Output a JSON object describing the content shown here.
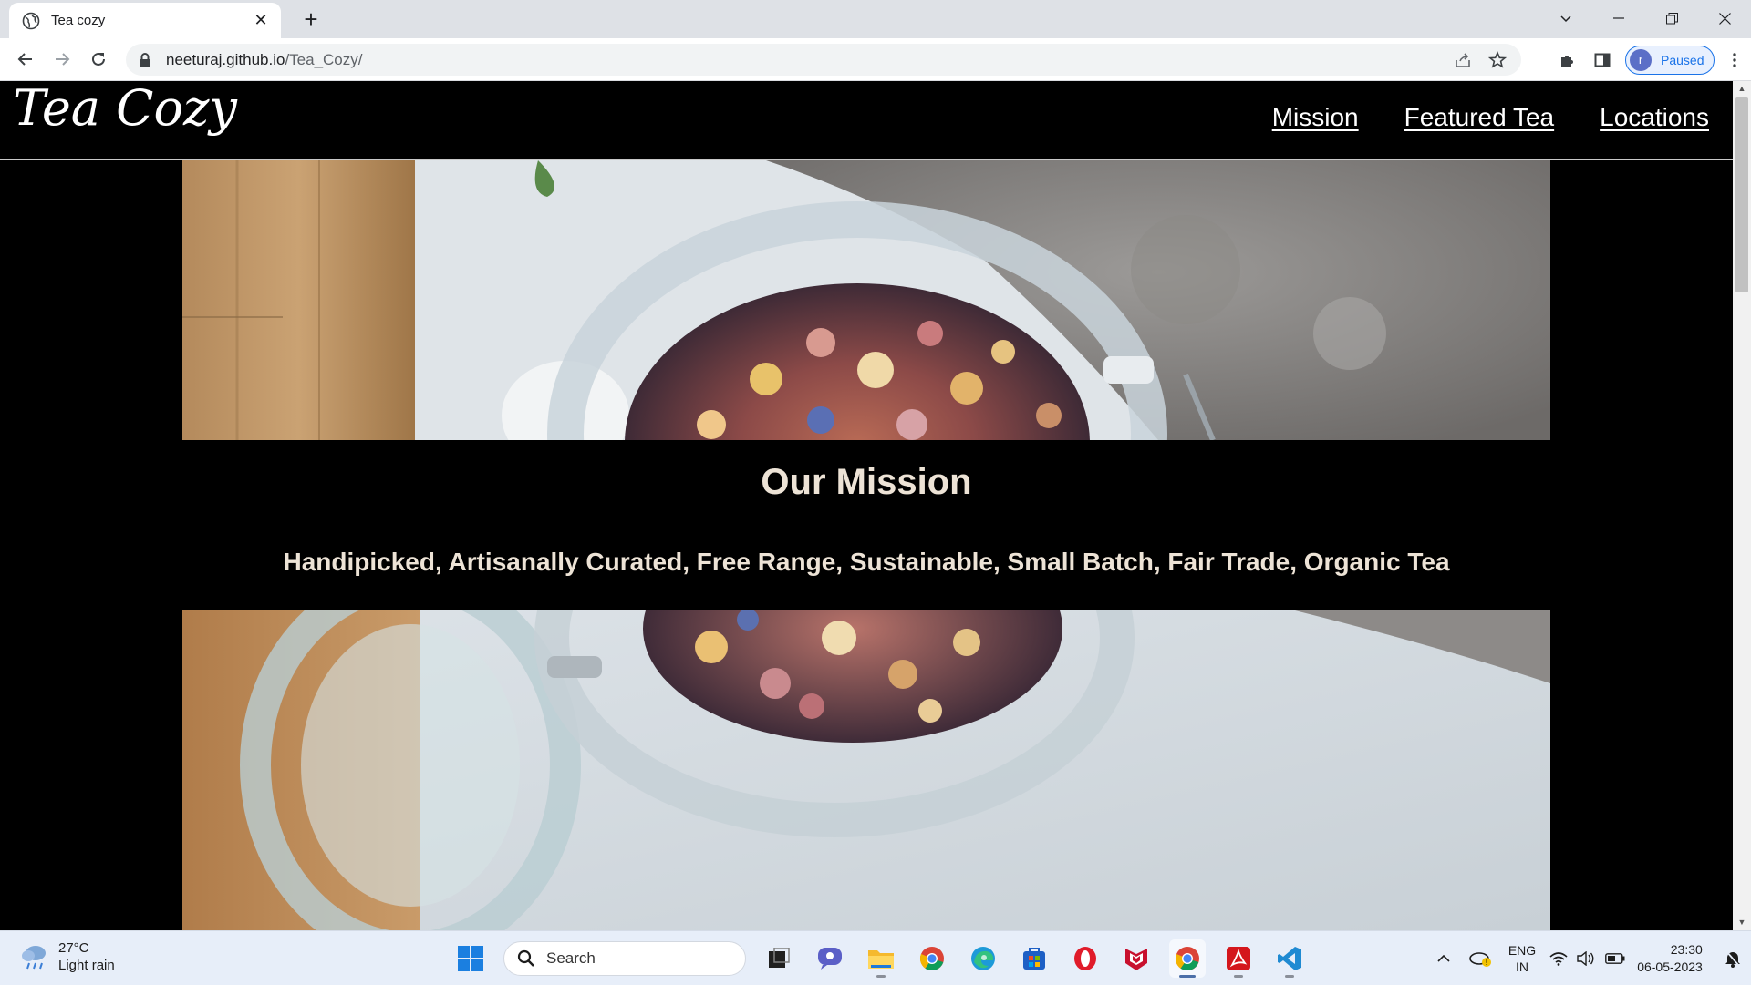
{
  "browser": {
    "tab_title": "Tea cozy",
    "url_host": "neeturaj.github.io",
    "url_path": "/Tea_Cozy/",
    "profile_initial": "r",
    "profile_status": "Paused"
  },
  "site": {
    "logo": "Tea Cozy",
    "nav": [
      "Mission",
      "Featured Tea",
      "Locations"
    ],
    "mission_title": "Our Mission",
    "mission_subtitle": "Handipicked, Artisanally Curated, Free Range, Sustainable, Small Batch, Fair Trade, Organic Tea"
  },
  "taskbar": {
    "weather_temp": "27°C",
    "weather_desc": "Light rain",
    "search_label": "Search",
    "lang": "ENG",
    "region": "IN",
    "time": "23:30",
    "date": "06-05-2023"
  },
  "colors": {
    "page_bg": "#000000",
    "heading_text": "#ede3d6",
    "link_text": "#ffffff"
  }
}
